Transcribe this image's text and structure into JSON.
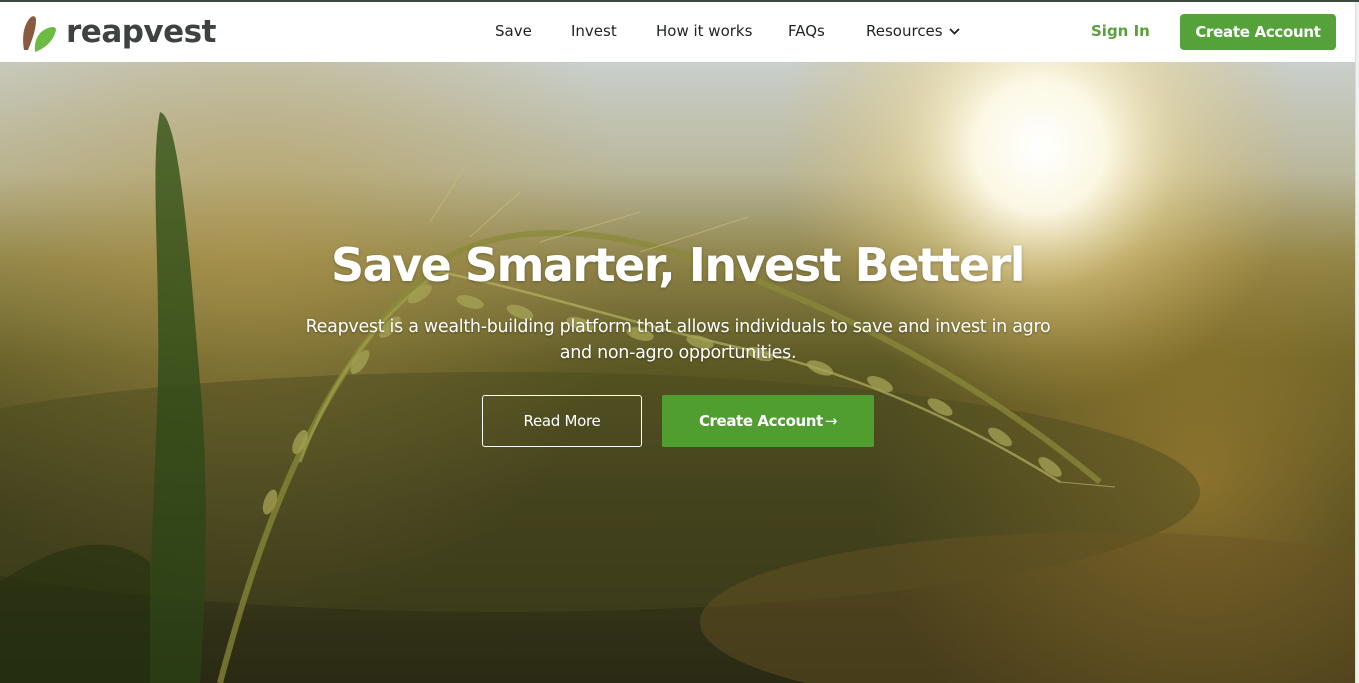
{
  "brand": {
    "name": "reapvest",
    "leaf_colors": {
      "left": "#8a5a3f",
      "right": "#6dbb45"
    },
    "text_color": "#3d4340"
  },
  "nav": {
    "items": [
      {
        "label": "Save"
      },
      {
        "label": "Invest"
      },
      {
        "label": "How it works"
      },
      {
        "label": "FAQs"
      },
      {
        "label": "Resources",
        "icon": "chevron-down-icon"
      }
    ],
    "sign_in": "Sign In",
    "create_account": "Create Account"
  },
  "hero": {
    "title": "Save Smarter, Invest Betterl",
    "subtitle": "Reapvest is a wealth-building platform that allows individuals to save and invest in agro and non-agro opportunities.",
    "read_more": "Read More",
    "create_account": "Create Account",
    "create_account_icon": "arrow-right-icon",
    "background": "rice-field-sunset-photo"
  },
  "colors": {
    "accent": "#55a13a",
    "sign_in": "#5aa03c"
  }
}
